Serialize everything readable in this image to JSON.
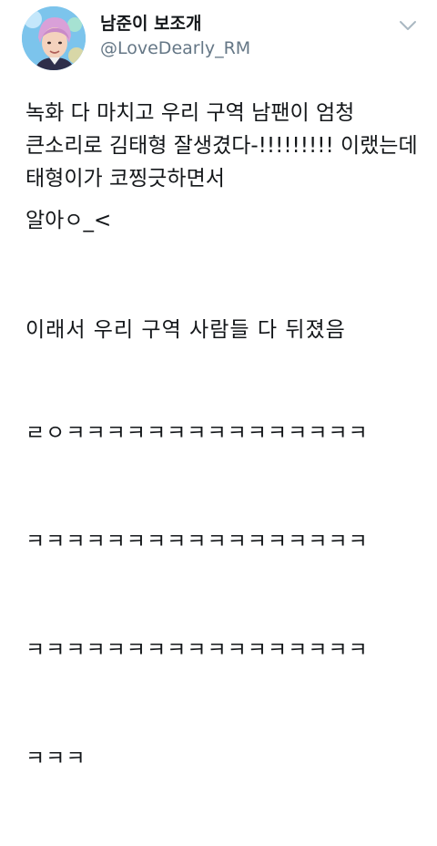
{
  "user": {
    "display_name": "남준이 보조개",
    "handle": "@LoveDearly_RM"
  },
  "icons": {
    "avatar": "profile-photo-avatar",
    "menu": "chevron-down-icon"
  },
  "colors": {
    "text_primary": "#14171a",
    "text_secondary": "#657786",
    "chevron": "#aab8c2"
  },
  "tweet": {
    "paragraph_1": "녹화 다 마치고 우리 구역 남팬이 엄청 큰소리로 김태형 잘생겼다-!!!!!!!!! 이랬는데 태형이가 코찡긋하면서",
    "paragraph_2": "알아ㅇ_<",
    "paragraph_3_line_1": "이래서 우리 구역 사람들 다 뒤졌음",
    "laugh_lines": [
      "ㄹㅇㅋㅋㅋㅋㅋㅋㅋㅋㅋㅋㅋㅋㅋㅋㅋ",
      "ㅋㅋㅋㅋㅋㅋㅋㅋㅋㅋㅋㅋㅋㅋㅋㅋㅋ",
      "ㅋㅋㅋㅋㅋㅋㅋㅋㅋㅋㅋㅋㅋㅋㅋㅋㅋ",
      "ㅋㅋㅋ"
    ]
  }
}
